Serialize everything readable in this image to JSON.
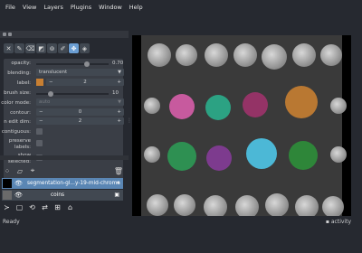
{
  "menubar": {
    "items": [
      "File",
      "View",
      "Layers",
      "Plugins",
      "Window",
      "Help"
    ]
  },
  "toolbar": {
    "tools": [
      {
        "name": "delete-shape-icon",
        "glyph": "✕"
      },
      {
        "name": "paint-brush-icon",
        "glyph": "✎"
      },
      {
        "name": "eraser-icon",
        "glyph": "⌫"
      },
      {
        "name": "fill-bucket-icon",
        "glyph": "◩"
      },
      {
        "name": "pick-label-icon",
        "glyph": "⊚"
      },
      {
        "name": "color-picker-icon",
        "glyph": "✐"
      },
      {
        "name": "pan-zoom-icon",
        "glyph": "✥"
      },
      {
        "name": "transform-icon",
        "glyph": "◈"
      }
    ]
  },
  "controls": {
    "opacity": {
      "label": "opacity:",
      "value": "0.70",
      "fraction": 0.7
    },
    "blending": {
      "label": "blending:",
      "value": "translucent"
    },
    "label": {
      "label": "label:",
      "value": "2",
      "color": "#c87f32"
    },
    "brush_size": {
      "label": "brush size:",
      "value": "10",
      "fraction": 0.2
    },
    "color_mode": {
      "label": "color mode:",
      "value": "auto"
    },
    "contour": {
      "label": "contour:",
      "value": "0"
    },
    "n_edit_dim": {
      "label": "n edit dim:",
      "value": "2"
    },
    "contiguous": {
      "label": "contiguous:"
    },
    "preserve_labels": {
      "label1": "preserve",
      "label2": "labels:"
    },
    "show_selected": {
      "label1": "show",
      "label2": "selected:"
    }
  },
  "layers": [
    {
      "name": "segmentation-gl...y-19-mid-chroma",
      "selected": true
    },
    {
      "name": "coins",
      "selected": false
    }
  ],
  "status": {
    "ready": "Ready",
    "activity": "activity"
  },
  "colors": {
    "accent": "#5a86b4",
    "background": "#262930",
    "panel": "#3a3e46"
  }
}
